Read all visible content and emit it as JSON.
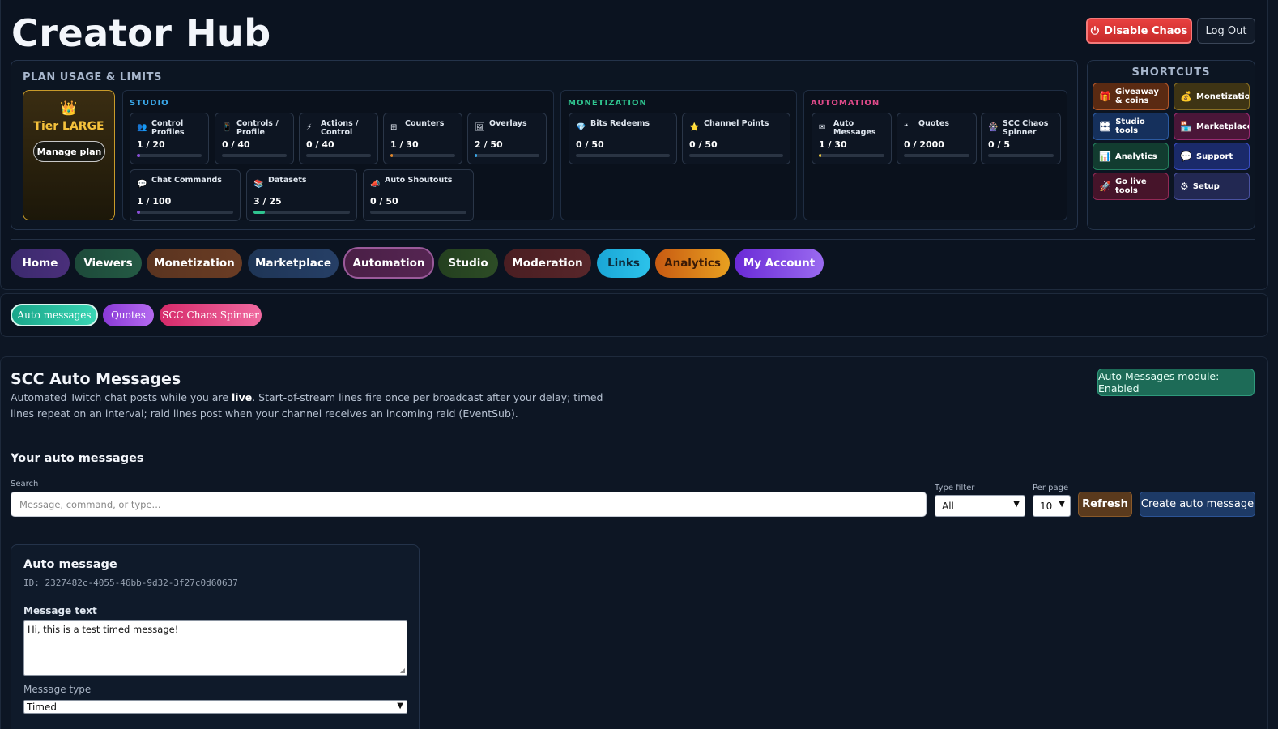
{
  "app": {
    "title": "Creator Hub",
    "disable_chaos": "Disable Chaos",
    "logout": "Log Out"
  },
  "plan": {
    "heading": "PLAN USAGE & LIMITS",
    "tier": {
      "name": "Tier LARGE",
      "manage": "Manage plan",
      "icon": "crown-icon"
    },
    "groups": [
      {
        "label": "STUDIO",
        "color": "#3aa7e8",
        "cards": [
          {
            "label": "Control Profiles",
            "value": "1 / 20",
            "fraction": 0.05,
            "icon": "users-icon",
            "glyph": "👥",
            "fill": "#8a4dd8"
          },
          {
            "label": "Controls / Profile",
            "value": "0 / 40",
            "fraction": 0,
            "icon": "phone-icon",
            "glyph": "📱",
            "fill": "#8a4dd8"
          },
          {
            "label": "Actions / Control",
            "value": "0 / 40",
            "fraction": 0,
            "icon": "bolt-icon",
            "glyph": "⚡",
            "fill": "#e05a2a"
          },
          {
            "label": "Counters",
            "value": "1 / 30",
            "fraction": 0.033,
            "icon": "grid-icon",
            "glyph": "⊞",
            "fill": "#e0862a"
          },
          {
            "label": "Overlays",
            "value": "2 / 50",
            "fraction": 0.04,
            "icon": "picture-icon",
            "glyph": "🖼",
            "fill": "#3aa7e8"
          },
          {
            "label": "Chat Commands",
            "value": "1 / 100",
            "fraction": 0.01,
            "icon": "chat-icon",
            "glyph": "💬",
            "fill": "#8a4dd8"
          },
          {
            "label": "Datasets",
            "value": "3 / 25",
            "fraction": 0.12,
            "icon": "books-icon",
            "glyph": "📚",
            "fill": "#2fc48f"
          },
          {
            "label": "Auto Shoutouts",
            "value": "0 / 50",
            "fraction": 0,
            "icon": "megaphone-icon",
            "glyph": "📣",
            "fill": "#8a4dd8"
          }
        ]
      },
      {
        "label": "MONETIZATION",
        "color": "#2fc48f",
        "cards": [
          {
            "label": "Bits Redeems",
            "value": "0 / 50",
            "fraction": 0,
            "icon": "gem-icon",
            "glyph": "💎",
            "fill": "#3aa7e8"
          },
          {
            "label": "Channel Points",
            "value": "0 / 50",
            "fraction": 0,
            "icon": "star-icon",
            "glyph": "⭐",
            "fill": "#e8c33a"
          }
        ]
      },
      {
        "label": "AUTOMATION",
        "color": "#e04a8a",
        "cards": [
          {
            "label": "Auto Messages",
            "value": "1 / 30",
            "fraction": 0.033,
            "icon": "envelope-icon",
            "glyph": "✉",
            "fill": "#e8c33a"
          },
          {
            "label": "Quotes",
            "value": "0 / 2000",
            "fraction": 0,
            "icon": "quote-icon",
            "glyph": "❝",
            "fill": "#8a4dd8"
          },
          {
            "label": "SCC Chaos Spinner",
            "value": "0 / 5",
            "fraction": 0,
            "icon": "spinner-icon",
            "glyph": "🎡",
            "fill": "#8a4dd8"
          }
        ]
      }
    ]
  },
  "shortcuts": {
    "heading": "SHORTCUTS",
    "items": [
      {
        "label": "Giveaway & coins",
        "icon": "gift-icon",
        "glyph": "🎁",
        "bg": "#5a2a12",
        "border": "#b4582a"
      },
      {
        "label": "Monetization",
        "icon": "money-bag-icon",
        "glyph": "💰",
        "bg": "#3e3414",
        "border": "#8a7024"
      },
      {
        "label": "Studio tools",
        "icon": "studio-icon",
        "glyph": "🎛",
        "bg": "#15305c",
        "border": "#2c5aa0"
      },
      {
        "label": "Marketplace",
        "icon": "store-icon",
        "glyph": "🏪",
        "bg": "#4a1638",
        "border": "#9a2c72"
      },
      {
        "label": "Analytics",
        "icon": "chart-icon",
        "glyph": "📊",
        "bg": "#123c30",
        "border": "#24805e"
      },
      {
        "label": "Support",
        "icon": "speech-icon",
        "glyph": "💬",
        "bg": "#1a2a6a",
        "border": "#3a4ec4"
      },
      {
        "label": "Go live tools",
        "icon": "rocket-icon",
        "glyph": "🚀",
        "bg": "#46142a",
        "border": "#922a56"
      },
      {
        "label": "Setup",
        "icon": "gear-icon",
        "glyph": "⚙",
        "bg": "#222852",
        "border": "#4a52a0"
      }
    ]
  },
  "tabs": [
    {
      "label": "Home",
      "bg": "linear-gradient(90deg,#3b2a6e,#4a2f7a)"
    },
    {
      "label": "Viewers",
      "bg": "linear-gradient(90deg,#1d4a3a,#245a44)"
    },
    {
      "label": "Monetization",
      "bg": "linear-gradient(90deg,#5a3420,#6a3c24)"
    },
    {
      "label": "Marketplace",
      "bg": "linear-gradient(90deg,#1e3556,#263f66)"
    },
    {
      "label": "Automation",
      "bg": "linear-gradient(90deg,#4a1f46,#552552)"
    },
    {
      "label": "Studio",
      "bg": "linear-gradient(90deg,#24401f,#2d4c26)"
    },
    {
      "label": "Moderation",
      "bg": "linear-gradient(90deg,#4a1e22,#58262a)"
    },
    {
      "label": "Links",
      "bg": "linear-gradient(90deg,#1aa6d6,#2cc2ea)"
    },
    {
      "label": "Analytics",
      "bg": "linear-gradient(90deg,#c85a12,#e8a020)"
    },
    {
      "label": "My Account",
      "bg": "linear-gradient(90deg,#6a2ad6,#9a6af0)"
    }
  ],
  "subtabs": [
    {
      "label": "Auto messages",
      "bg": "linear-gradient(90deg,#1aa68a,#3ad6b4)"
    },
    {
      "label": "Quotes",
      "bg": "linear-gradient(90deg,#8a3ad6,#b46af0)"
    },
    {
      "label": "SCC Chaos Spinner",
      "bg": "linear-gradient(90deg,#d62a6a,#f06aa0)"
    }
  ],
  "main": {
    "title": "SCC Auto Messages",
    "desc_pre": "Automated Twitch chat posts while you are ",
    "desc_bold": "live",
    "desc_post": ". Start-of-stream lines fire once per broadcast after your delay; timed lines repeat on an interval; raid lines post when your channel receives an incoming raid (EventSub).",
    "status": "Auto Messages module: Enabled",
    "list_title": "Your auto messages",
    "search_label": "Search",
    "search_placeholder": "Message, command, or type...",
    "type_filter_label": "Type filter",
    "type_filter_value": "All",
    "per_page_label": "Per page",
    "per_page_value": "10",
    "refresh": "Refresh",
    "create": "Create auto message"
  },
  "message_card": {
    "title": "Auto message",
    "id": "ID: 2327482c-4055-46bb-9d32-3f27c0d60637",
    "text_label": "Message text",
    "text_value": "Hi, this is a test timed message!",
    "type_label": "Message type",
    "type_value": "Timed"
  }
}
